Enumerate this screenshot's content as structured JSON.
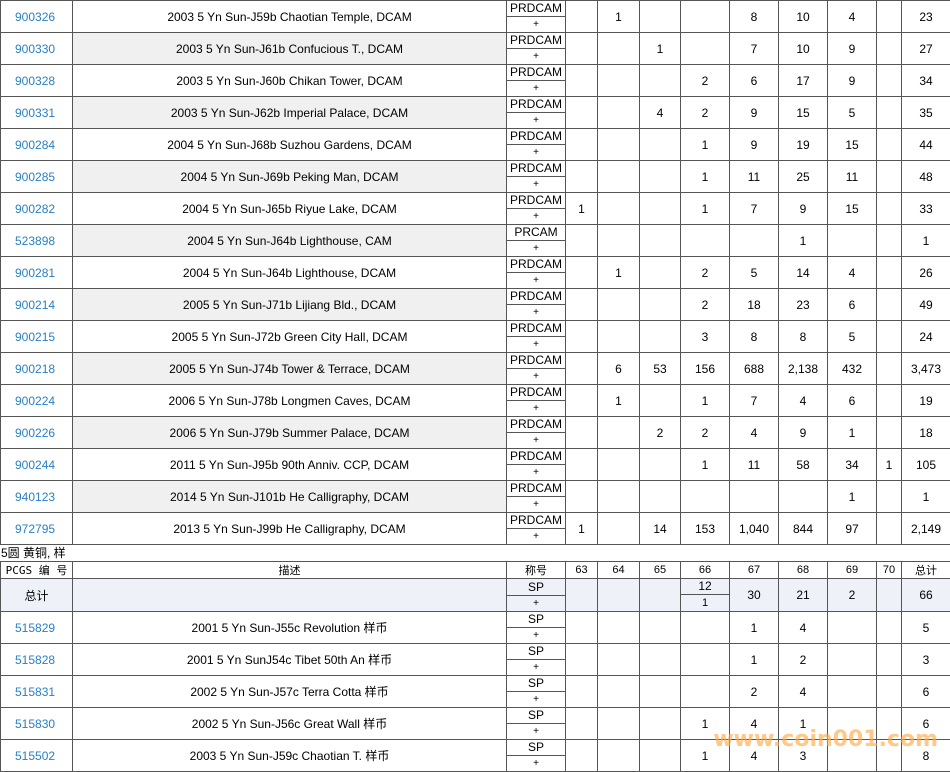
{
  "top_rows": [
    {
      "id": "900326",
      "desc": "2003 5 Yn Sun-J59b Chaotian Temple, DCAM",
      "grade": "PRDCAM",
      "plus": "+",
      "cells": [
        "",
        "1",
        "",
        "",
        "8",
        "10",
        "4",
        "",
        "23"
      ]
    },
    {
      "id": "900330",
      "desc": "2003 5 Yn Sun-J61b Confucious T., DCAM",
      "grade": "PRDCAM",
      "plus": "+",
      "cells": [
        "",
        "",
        "1",
        "",
        "7",
        "10",
        "9",
        "",
        "27"
      ]
    },
    {
      "id": "900328",
      "desc": "2003 5 Yn Sun-J60b Chikan Tower, DCAM",
      "grade": "PRDCAM",
      "plus": "+",
      "cells": [
        "",
        "",
        "",
        "2",
        "6",
        "17",
        "9",
        "",
        "34"
      ]
    },
    {
      "id": "900331",
      "desc": "2003 5 Yn Sun-J62b Imperial Palace, DCAM",
      "grade": "PRDCAM",
      "plus": "+",
      "cells": [
        "",
        "",
        "4",
        "2",
        "9",
        "15",
        "5",
        "",
        "35"
      ]
    },
    {
      "id": "900284",
      "desc": "2004 5 Yn Sun-J68b Suzhou Gardens, DCAM",
      "grade": "PRDCAM",
      "plus": "+",
      "cells": [
        "",
        "",
        "",
        "1",
        "9",
        "19",
        "15",
        "",
        "44"
      ]
    },
    {
      "id": "900285",
      "desc": "2004 5 Yn Sun-J69b Peking Man, DCAM",
      "grade": "PRDCAM",
      "plus": "+",
      "cells": [
        "",
        "",
        "",
        "1",
        "11",
        "25",
        "11",
        "",
        "48"
      ]
    },
    {
      "id": "900282",
      "desc": "2004 5 Yn Sun-J65b Riyue Lake, DCAM",
      "grade": "PRDCAM",
      "plus": "+",
      "cells": [
        "1",
        "",
        "",
        "1",
        "7",
        "9",
        "15",
        "",
        "33"
      ]
    },
    {
      "id": "523898",
      "desc": "2004 5 Yn Sun-J64b Lighthouse, CAM",
      "grade": "PRCAM",
      "plus": "+",
      "cells": [
        "",
        "",
        "",
        "",
        "",
        "1",
        "",
        "",
        "1"
      ]
    },
    {
      "id": "900281",
      "desc": "2004 5 Yn Sun-J64b Lighthouse, DCAM",
      "grade": "PRDCAM",
      "plus": "+",
      "cells": [
        "",
        "1",
        "",
        "2",
        "5",
        "14",
        "4",
        "",
        "26"
      ]
    },
    {
      "id": "900214",
      "desc": "2005 5 Yn Sun-J71b Lijiang Bld., DCAM",
      "grade": "PRDCAM",
      "plus": "+",
      "cells": [
        "",
        "",
        "",
        "2",
        "18",
        "23",
        "6",
        "",
        "49"
      ]
    },
    {
      "id": "900215",
      "desc": "2005 5 Yn Sun-J72b Green City Hall, DCAM",
      "grade": "PRDCAM",
      "plus": "+",
      "cells": [
        "",
        "",
        "",
        "3",
        "8",
        "8",
        "5",
        "",
        "24"
      ]
    },
    {
      "id": "900218",
      "desc": "2005 5 Yn Sun-J74b Tower & Terrace, DCAM",
      "grade": "PRDCAM",
      "plus": "+",
      "cells": [
        "",
        "6",
        "53",
        "156",
        "688",
        "2,138",
        "432",
        "",
        "3,473"
      ]
    },
    {
      "id": "900224",
      "desc": "2006 5 Yn Sun-J78b Longmen Caves, DCAM",
      "grade": "PRDCAM",
      "plus": "+",
      "cells": [
        "",
        "1",
        "",
        "1",
        "7",
        "4",
        "6",
        "",
        "19"
      ]
    },
    {
      "id": "900226",
      "desc": "2006 5 Yn Sun-J79b Summer Palace, DCAM",
      "grade": "PRDCAM",
      "plus": "+",
      "cells": [
        "",
        "",
        "2",
        "2",
        "4",
        "9",
        "1",
        "",
        "18"
      ]
    },
    {
      "id": "900244",
      "desc": "2011 5 Yn Sun-J95b 90th Anniv. CCP, DCAM",
      "grade": "PRDCAM",
      "plus": "+",
      "cells": [
        "",
        "",
        "",
        "1",
        "11",
        "58",
        "34",
        "1",
        "105"
      ]
    },
    {
      "id": "940123",
      "desc": "2014 5 Yn Sun-J101b He Calligraphy, DCAM",
      "grade": "PRDCAM",
      "plus": "+",
      "cells": [
        "",
        "",
        "",
        "",
        "",
        "",
        "1",
        "",
        "1"
      ]
    },
    {
      "id": "972795",
      "desc": "2013 5 Yn Sun-J99b He Calligraphy, DCAM",
      "grade": "PRDCAM",
      "plus": "+",
      "cells": [
        "1",
        "",
        "14",
        "153",
        "1,040",
        "844",
        "97",
        "",
        "2,149"
      ]
    }
  ],
  "section": {
    "title": "5圆 黄铜, 样",
    "headers": {
      "pcgs": "PCGS 编 号",
      "desc": "描述",
      "grade": "称号",
      "cols": [
        "63",
        "64",
        "65",
        "66",
        "67",
        "68",
        "69",
        "70",
        "总计"
      ]
    },
    "total": {
      "label": "总计",
      "grade": "SP",
      "plus": "+",
      "g66_top": "12",
      "g66_bottom": "1",
      "cells": [
        "",
        "",
        "",
        "",
        "30",
        "21",
        "2",
        "",
        "66"
      ]
    },
    "rows": [
      {
        "id": "515829",
        "desc": "2001 5 Yn Sun-J55c Revolution 样币",
        "grade": "SP",
        "plus": "+",
        "cells": [
          "",
          "",
          "",
          "",
          "1",
          "4",
          "",
          "",
          "5"
        ]
      },
      {
        "id": "515828",
        "desc": "2001 5 Yn SunJ54c Tibet 50th An 样币",
        "grade": "SP",
        "plus": "+",
        "cells": [
          "",
          "",
          "",
          "",
          "1",
          "2",
          "",
          "",
          "3"
        ]
      },
      {
        "id": "515831",
        "desc": "2002 5 Yn Sun-J57c Terra Cotta 样币",
        "grade": "SP",
        "plus": "+",
        "cells": [
          "",
          "",
          "",
          "",
          "2",
          "4",
          "",
          "",
          "6"
        ]
      },
      {
        "id": "515830",
        "desc": "2002 5 Yn Sun-J56c Great Wall 样币",
        "grade": "SP",
        "plus": "+",
        "cells": [
          "",
          "",
          "",
          "1",
          "4",
          "1",
          "",
          "",
          "6"
        ]
      },
      {
        "id": "515502",
        "desc": "2003 5 Yn Sun-J59c Chaotian T. 样币",
        "grade": "SP",
        "plus": "+",
        "cells": [
          "",
          "",
          "",
          "1",
          "4",
          "3",
          "",
          "",
          "8"
        ]
      }
    ]
  },
  "watermark": "www.coin001.com"
}
